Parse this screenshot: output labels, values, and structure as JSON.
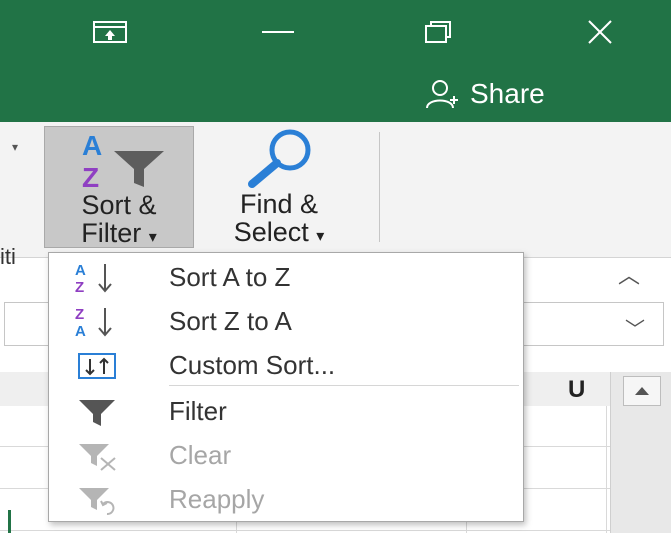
{
  "share": {
    "label": "Share"
  },
  "ribbon": {
    "sort_filter": {
      "line1": "Sort &",
      "line2": "Filter",
      "caret": "▾"
    },
    "find_select": {
      "line1": "Find &",
      "line2": "Select",
      "caret": "▾"
    },
    "group_label_fragment": "iti"
  },
  "grid": {
    "column_header": "U"
  },
  "menu": {
    "items": [
      {
        "label": "Sort A to Z",
        "enabled": true
      },
      {
        "label": "Sort Z to A",
        "enabled": true
      },
      {
        "label": "Custom Sort...",
        "enabled": true
      },
      {
        "label": "Filter",
        "enabled": true
      },
      {
        "label": "Clear",
        "enabled": false
      },
      {
        "label": "Reapply",
        "enabled": false
      }
    ]
  },
  "colors": {
    "title_bar": "#217346",
    "sort_glyph_blue": "#2a7fd6",
    "sort_glyph_purple": "#8f3fc2",
    "icon_gray": "#555555",
    "disabled_gray": "#a6a6a6"
  }
}
